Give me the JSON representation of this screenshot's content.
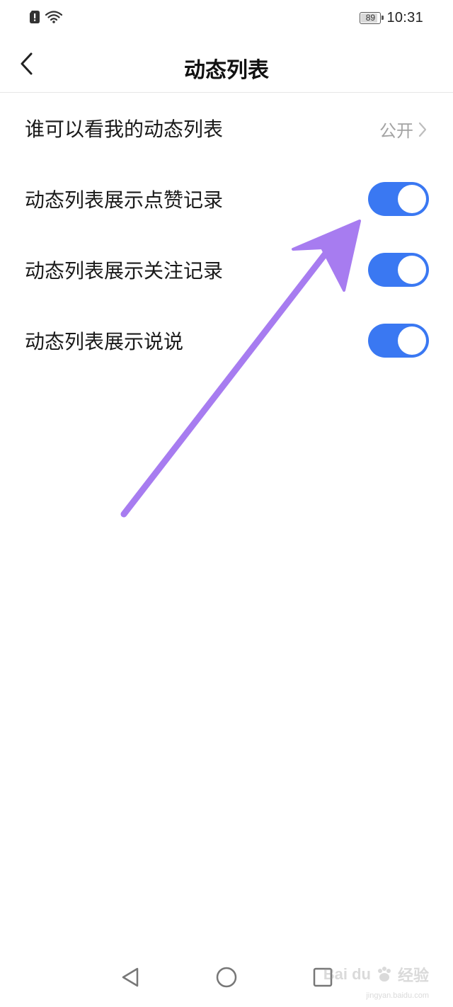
{
  "status_bar": {
    "battery_level": "89",
    "battery_fraction": 0.89,
    "time": "10:31",
    "icons": [
      "sim-alert-icon",
      "wifi-icon",
      "battery-icon"
    ]
  },
  "header": {
    "title": "动态列表",
    "back_icon": "chevron-left-icon"
  },
  "settings": {
    "visibility": {
      "label": "谁可以看我的动态列表",
      "value": "公开"
    },
    "toggles": [
      {
        "label": "动态列表展示点赞记录",
        "on": true
      },
      {
        "label": "动态列表展示关注记录",
        "on": true
      },
      {
        "label": "动态列表展示说说",
        "on": true
      }
    ]
  },
  "system_nav": {
    "icons": [
      "triangle-back-icon",
      "circle-home-icon",
      "square-recent-icon"
    ]
  },
  "colors": {
    "toggle_on": "#3a78f2",
    "annotation_arrow": "#a77cf0",
    "secondary_text": "#a3a3a3"
  },
  "watermark": {
    "logo": "Bai du",
    "suffix": "经验",
    "url": "jingyan.baidu.com"
  }
}
